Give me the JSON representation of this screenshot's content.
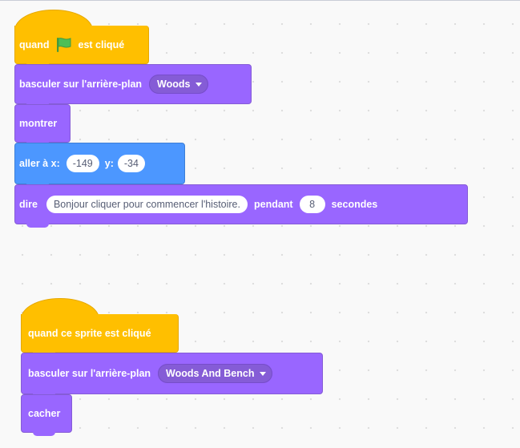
{
  "script1": {
    "hat": {
      "before": "quand",
      "after": "est cliqué",
      "icon": "green-flag-icon"
    },
    "switch_backdrop": {
      "label": "basculer sur l'arrière-plan",
      "value": "Woods"
    },
    "show": {
      "label": "montrer"
    },
    "goto": {
      "label": "aller à x:",
      "x": "-149",
      "y_label": "y:",
      "y": "-34"
    },
    "say": {
      "label": "dire",
      "message": "Bonjour cliquer pour commencer l'histoire.",
      "for_label": "pendant",
      "secs": "8",
      "secs_label": "secondes"
    }
  },
  "script2": {
    "hat": {
      "label": "quand ce sprite est cliqué"
    },
    "switch_backdrop": {
      "label": "basculer sur l'arrière-plan",
      "value": "Woods And Bench"
    },
    "hide": {
      "label": "cacher"
    }
  },
  "colors": {
    "events": "#ffbf00",
    "looks": "#9966ff",
    "motion": "#4c97ff",
    "background": "#f9f9f9"
  }
}
